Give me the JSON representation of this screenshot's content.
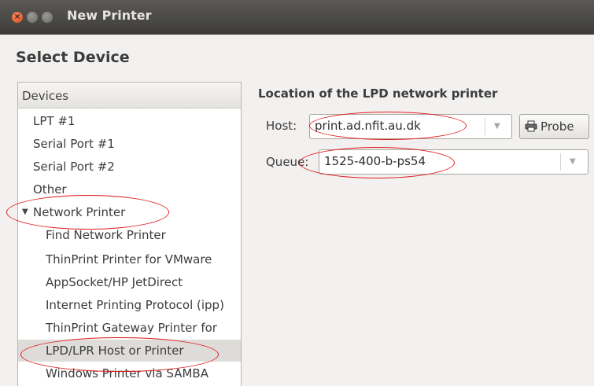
{
  "window": {
    "title": "New Printer"
  },
  "heading": "Select Device",
  "devices": {
    "header": "Devices",
    "items": [
      {
        "label": "LPT #1"
      },
      {
        "label": "Serial Port #1"
      },
      {
        "label": "Serial Port #2"
      },
      {
        "label": "Other"
      },
      {
        "label": "Network Printer",
        "expanded": true
      },
      {
        "label": "Find Network Printer"
      },
      {
        "label": "ThinPrint Printer for VMware"
      },
      {
        "label": "AppSocket/HP JetDirect"
      },
      {
        "label": "Internet Printing Protocol (ipp)"
      },
      {
        "label": "ThinPrint Gateway Printer for"
      },
      {
        "label": "LPD/LPR Host or Printer",
        "selected": true
      },
      {
        "label": "Windows Printer via SAMBA"
      }
    ]
  },
  "location": {
    "title": "Location of the LPD network printer",
    "host_label": "Host:",
    "host_value": "print.ad.nfit.au.dk",
    "probe_label": "Probe",
    "queue_label": "Queue:",
    "queue_value": "1525-400-b-ps54"
  },
  "colors": {
    "annotation": "#e01a1a",
    "titlebar": "#3d3c38",
    "close_button": "#d84a1b"
  },
  "icons": [
    "close-icon",
    "minimize-icon",
    "maximize-icon",
    "expander-triangle-icon",
    "dropdown-arrow-icon",
    "printer-icon"
  ]
}
